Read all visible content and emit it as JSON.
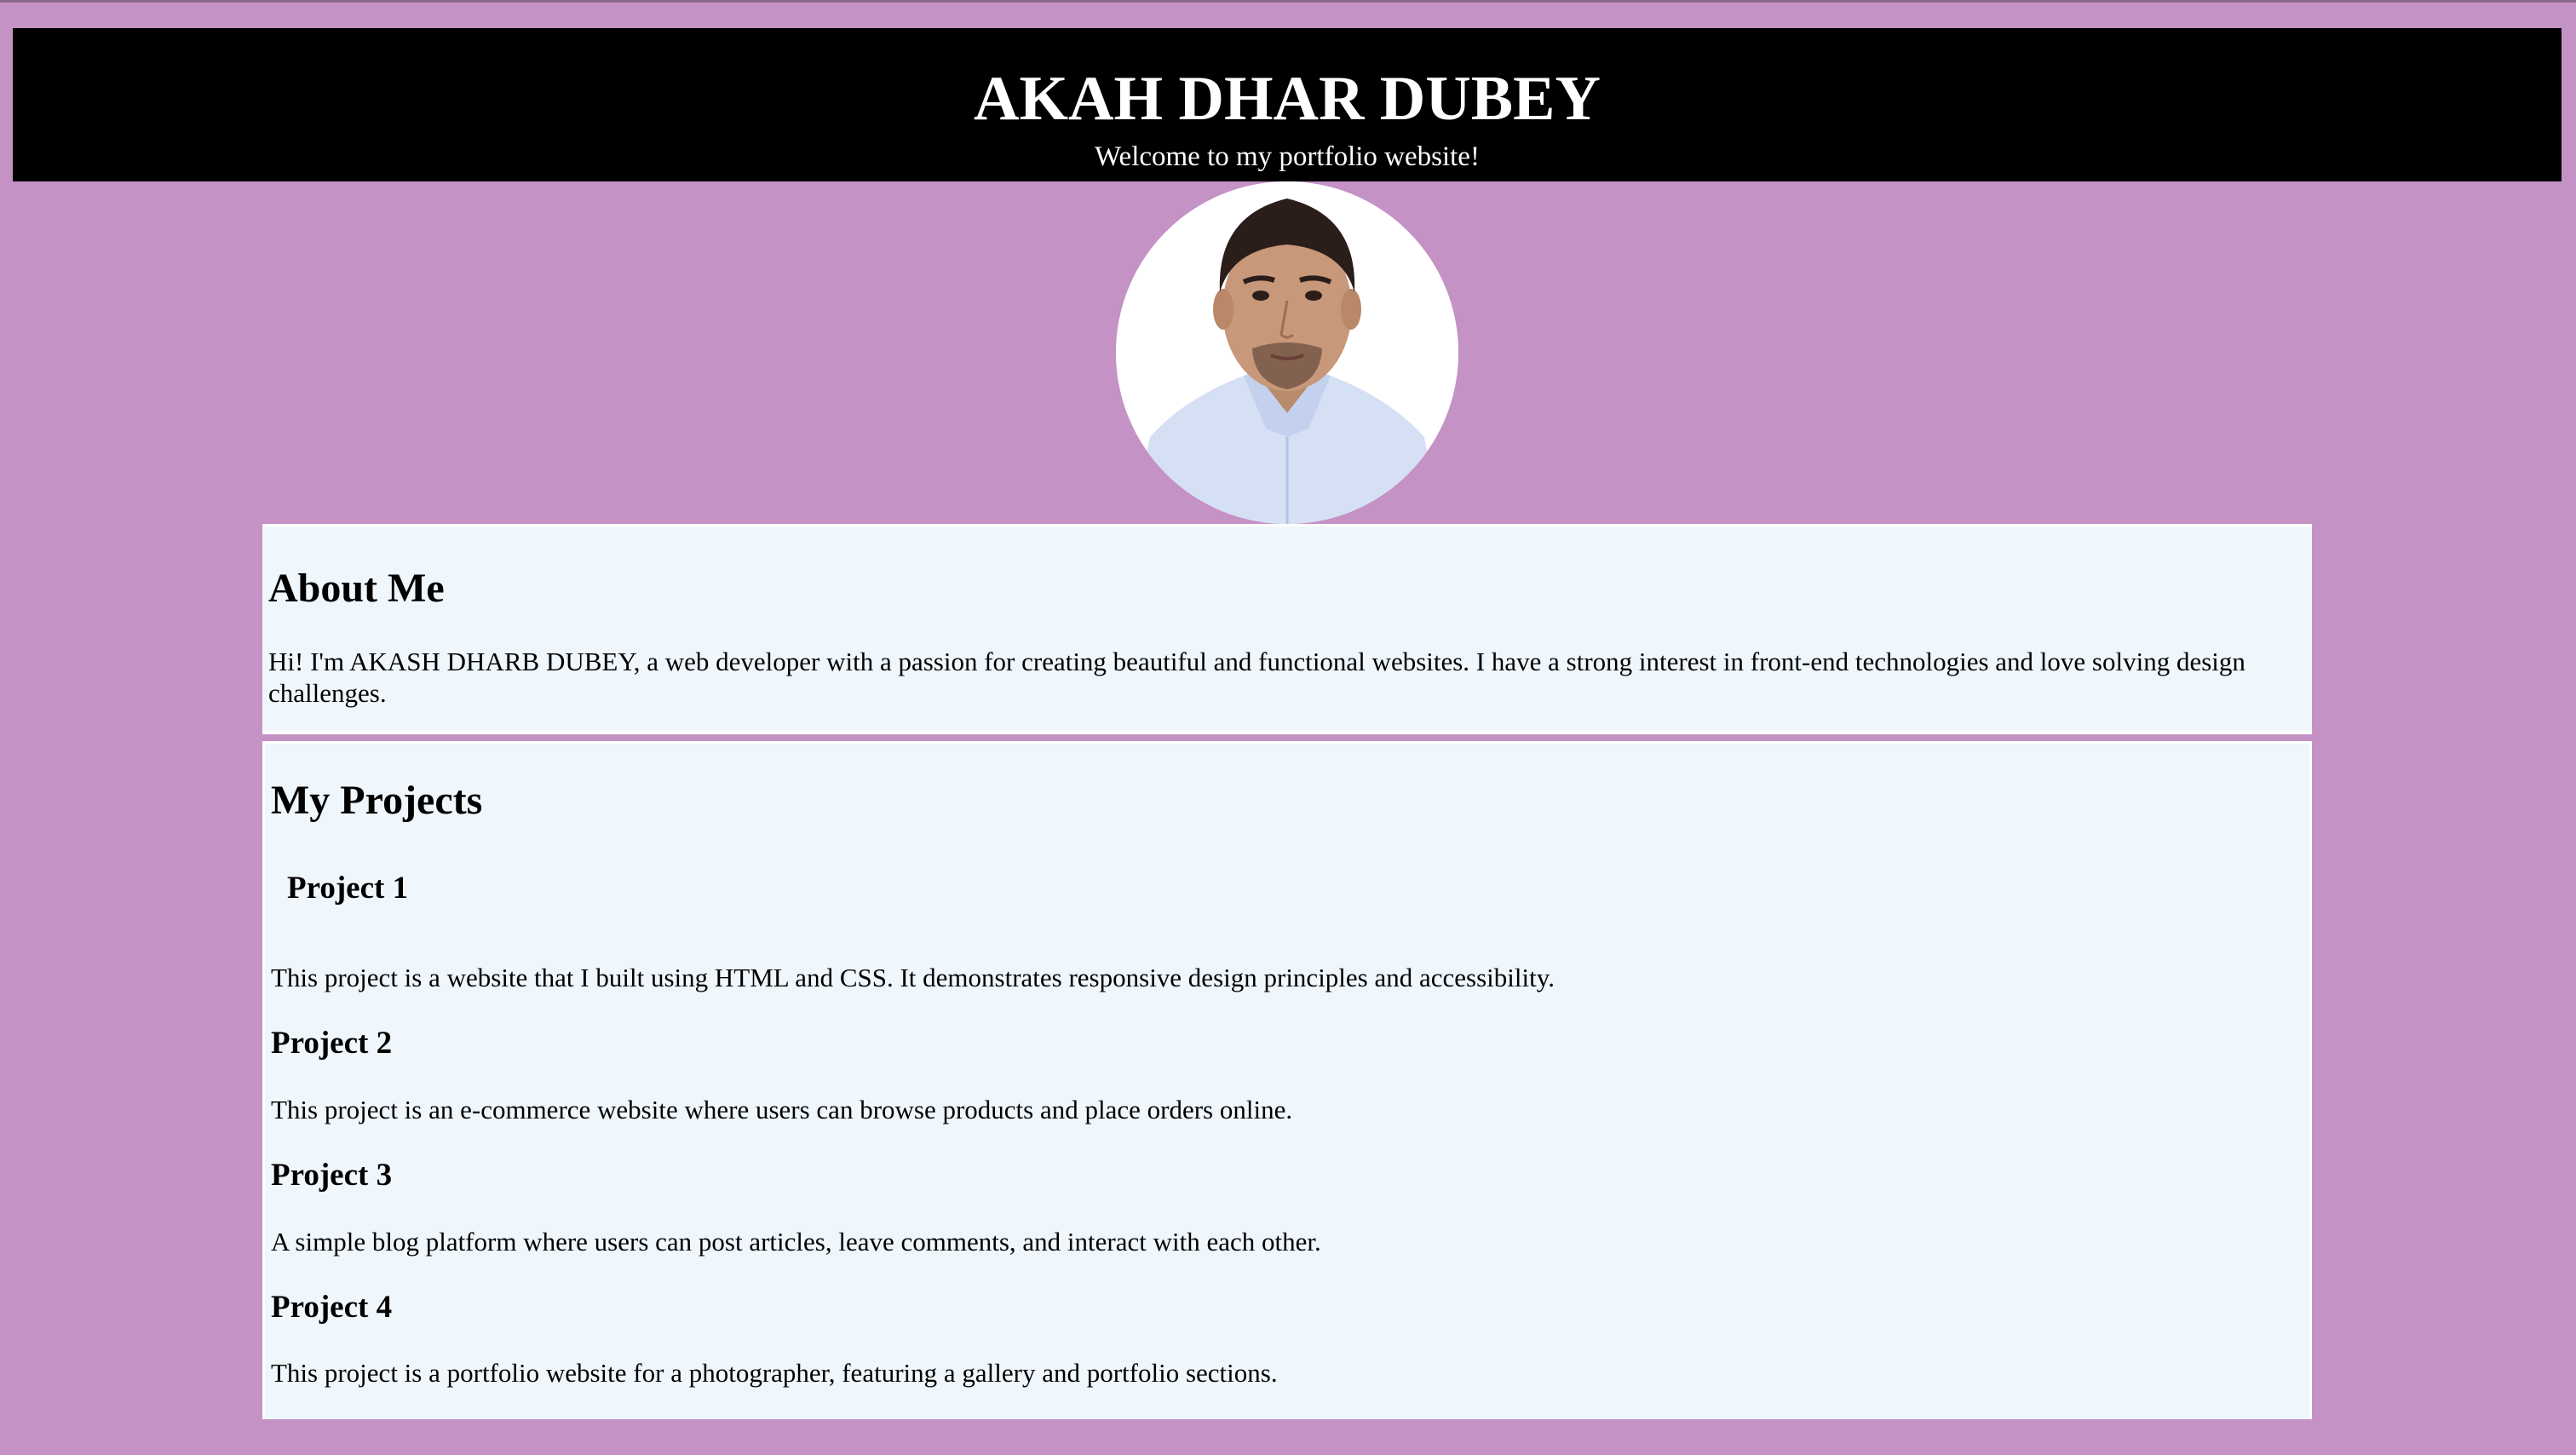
{
  "header": {
    "title": "AKAH DHAR DUBEY",
    "subtitle": "Welcome to my portfolio website!"
  },
  "profile": {
    "icon": "profile-photo"
  },
  "about": {
    "heading": "About Me",
    "text": "Hi! I'm AKASH DHARB DUBEY, a web developer with a passion for creating beautiful and functional websites. I have a strong interest in front-end technologies and love solving design challenges."
  },
  "projects": {
    "heading": "My Projects",
    "items": [
      {
        "title": "Project 1",
        "description": "This project is a website that I built using HTML and CSS. It demonstrates responsive design principles and accessibility."
      },
      {
        "title": "Project 2",
        "description": "This project is an e-commerce website where users can browse products and place orders online."
      },
      {
        "title": "Project 3",
        "description": "A simple blog platform where users can post articles, leave comments, and interact with each other."
      },
      {
        "title": "Project 4",
        "description": "This project is a portfolio website for a photographer, featuring a gallery and portfolio sections."
      }
    ]
  },
  "colors": {
    "page_background": "#c592c5",
    "header_background": "#000000",
    "section_background": "#eff6fc"
  }
}
